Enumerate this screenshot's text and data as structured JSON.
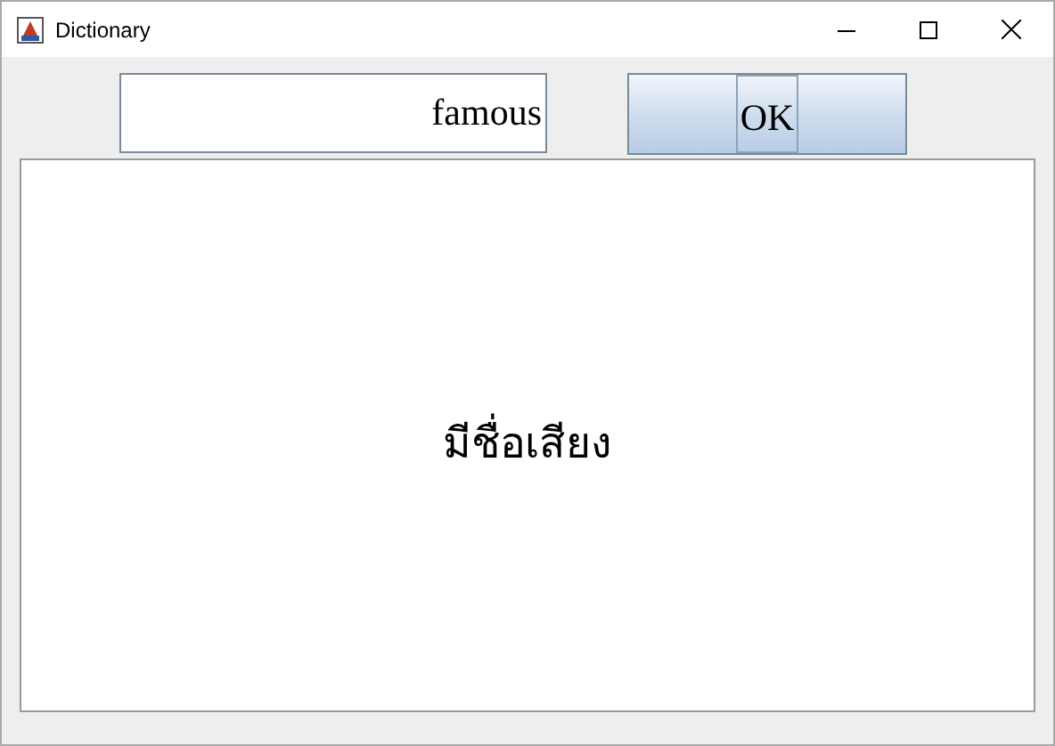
{
  "window": {
    "title": "Dictionary"
  },
  "search": {
    "value": "famous"
  },
  "button": {
    "label": "OK",
    "focused": true
  },
  "result": {
    "text": "มีชื่อเสียง"
  }
}
